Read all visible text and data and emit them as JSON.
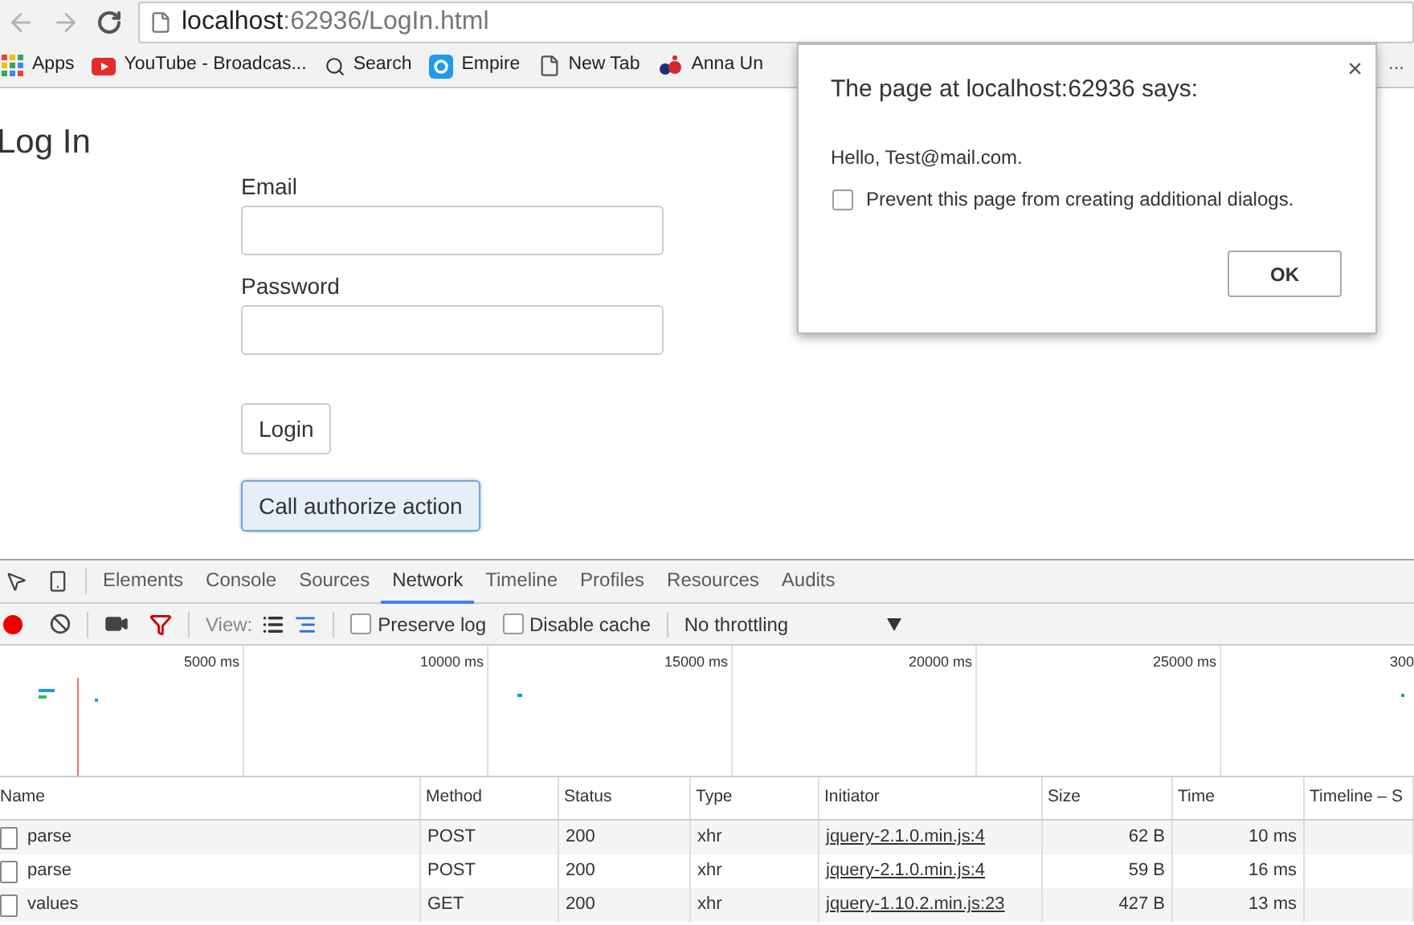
{
  "browser": {
    "address": {
      "host": "localhost",
      "rest": ":62936/LogIn.html"
    },
    "bookmarks": [
      {
        "label": "Apps",
        "kind": "apps"
      },
      {
        "label": "YouTube - Broadcas...",
        "kind": "youtube"
      },
      {
        "label": "Search",
        "kind": "search"
      },
      {
        "label": "Empire",
        "kind": "empire"
      },
      {
        "label": "New Tab",
        "kind": "page"
      },
      {
        "label": "Anna Un",
        "kind": "s9"
      }
    ],
    "bookmarks_overflow": "..."
  },
  "page": {
    "heading": "Log In",
    "fields": [
      {
        "label": "Email"
      },
      {
        "label": "Password"
      }
    ],
    "buttons": [
      {
        "label": "Login",
        "focused": false
      },
      {
        "label": "Call authorize action",
        "focused": true
      }
    ]
  },
  "dialog": {
    "title": "The page at localhost:62936 says:",
    "message": "Hello, Test@mail.com.",
    "checkbox": {
      "label": "Prevent this page from creating additional dialogs.",
      "checked": false
    },
    "close": "×",
    "button": "OK"
  },
  "devtools": {
    "tabs": [
      {
        "label": "Elements",
        "selected": false
      },
      {
        "label": "Console",
        "selected": false
      },
      {
        "label": "Sources",
        "selected": false
      },
      {
        "label": "Network",
        "selected": true
      },
      {
        "label": "Timeline",
        "selected": false
      },
      {
        "label": "Profiles",
        "selected": false
      },
      {
        "label": "Resources",
        "selected": false
      },
      {
        "label": "Audits",
        "selected": false
      }
    ],
    "toolbar": {
      "recording": true,
      "view_label": "View:",
      "checkboxes": [
        {
          "label": "Preserve log",
          "checked": false
        },
        {
          "label": "Disable cache",
          "checked": false
        }
      ],
      "throttling": "No throttling"
    },
    "overview_ticks": [
      "5000 ms",
      "10000 ms",
      "15000 ms",
      "20000 ms",
      "25000 ms",
      "300"
    ],
    "table": {
      "columns": [
        "Name",
        "Method",
        "Status",
        "Type",
        "Initiator",
        "Size",
        "Time",
        "Timeline – S"
      ],
      "rows": [
        [
          "parse",
          "POST",
          "200",
          "xhr",
          "jquery-2.1.0.min.js:4",
          "62 B",
          "10 ms"
        ],
        [
          "parse",
          "POST",
          "200",
          "xhr",
          "jquery-2.1.0.min.js:4",
          "59 B",
          "16 ms"
        ],
        [
          "values",
          "GET",
          "200",
          "xhr",
          "jquery-1.10.2.min.js:23",
          "427 B",
          "13 ms"
        ]
      ]
    }
  }
}
